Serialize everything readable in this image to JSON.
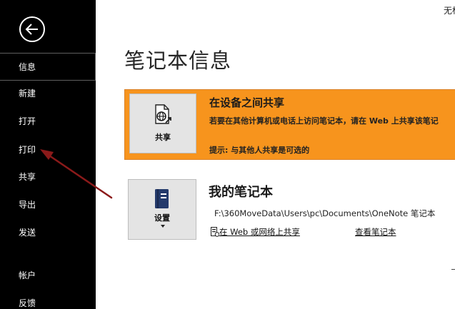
{
  "window": {
    "title": "无标"
  },
  "sidebar": {
    "back_icon": "back-arrow-icon",
    "items": [
      {
        "label": "信息",
        "active": true
      },
      {
        "label": "新建",
        "active": false
      },
      {
        "label": "打开",
        "active": false
      },
      {
        "label": "打印",
        "active": false
      },
      {
        "label": "共享",
        "active": false
      },
      {
        "label": "导出",
        "active": false
      },
      {
        "label": "发送",
        "active": false
      },
      {
        "label": "帐户",
        "active": false
      },
      {
        "label": "反馈",
        "active": false
      }
    ]
  },
  "main": {
    "page_title": "笔记本信息",
    "share_section": {
      "button_label": "共享",
      "icon": "share-globe-icon",
      "heading": "在设备之间共享",
      "description": "若要在其他计算机或电话上访问笔记本，请在 Web 上共享该笔记",
      "tip": "提示: 与其他人共享是可选的",
      "background": "#f7941d"
    },
    "notebook_section": {
      "button_label": "设置",
      "icon": "notebook-icon",
      "heading": "我的笔记本",
      "path": "F:\\360MoveData\\Users\\pc\\Documents\\OneNote 笔记本",
      "share_link": "在 Web 或网络上共享",
      "view_link": "查看笔记本"
    }
  },
  "colors": {
    "sidebar_bg": "#000000",
    "accent_orange": "#f7941d",
    "annotation_arrow": "#8b1a1a"
  }
}
